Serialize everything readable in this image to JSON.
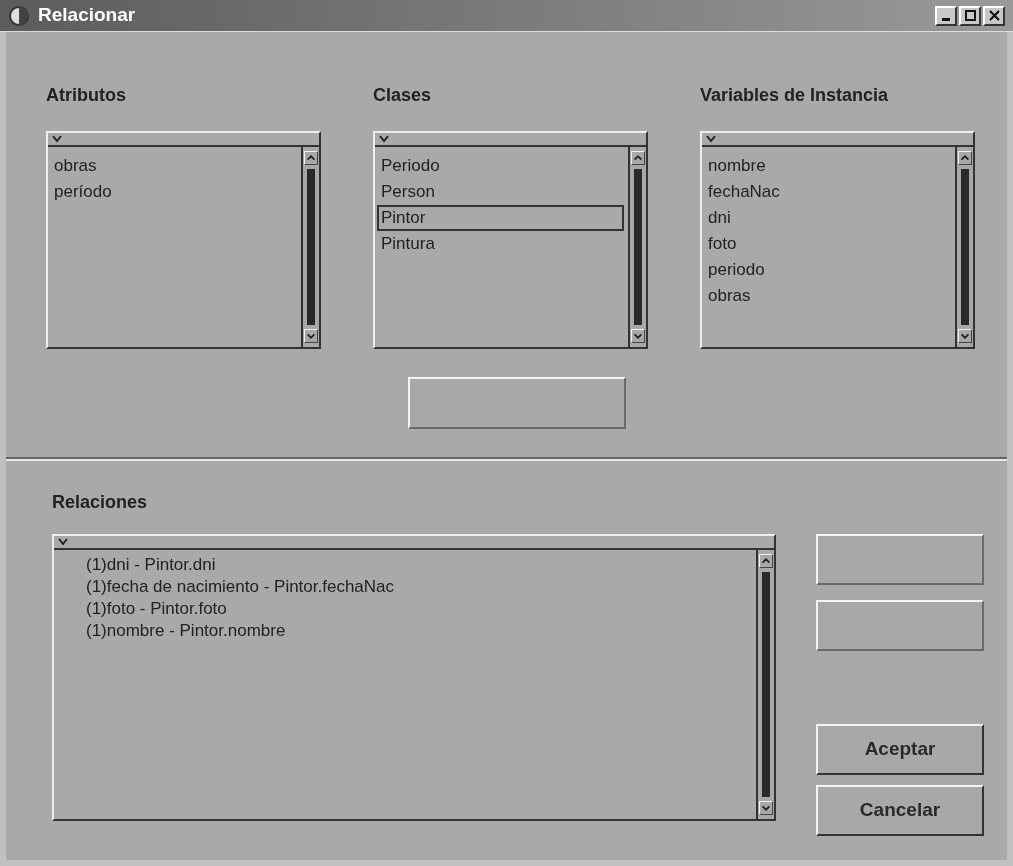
{
  "window": {
    "title": "Relacionar"
  },
  "lists": [
    {
      "label": "Atributos",
      "items": [
        {
          "text": "obras",
          "selected": false
        },
        {
          "text": "período",
          "selected": false
        }
      ]
    },
    {
      "label": "Clases",
      "items": [
        {
          "text": "Periodo",
          "selected": false
        },
        {
          "text": "Person",
          "selected": false
        },
        {
          "text": "Pintor",
          "selected": true
        },
        {
          "text": "Pintura",
          "selected": false
        }
      ]
    },
    {
      "label": "Variables de Instancia",
      "items": [
        {
          "text": "nombre",
          "selected": false
        },
        {
          "text": "fechaNac",
          "selected": false
        },
        {
          "text": "dni",
          "selected": false
        },
        {
          "text": "foto",
          "selected": false
        },
        {
          "text": "periodo",
          "selected": false
        },
        {
          "text": "obras",
          "selected": false
        }
      ]
    }
  ],
  "middle_button": {
    "disabled": true
  },
  "relations": {
    "label": "Relaciones",
    "items": [
      "(1)dni - Pintor.dni",
      "(1)fecha de nacimiento - Pintor.fechaNac",
      "(1)foto - Pintor.foto",
      "(1)nombre - Pintor.nombre"
    ]
  },
  "side_buttons": [
    {
      "disabled": true
    },
    {
      "disabled": true
    },
    {
      "label": "Aceptar",
      "disabled": false
    },
    {
      "label": "Cancelar",
      "disabled": false
    }
  ]
}
